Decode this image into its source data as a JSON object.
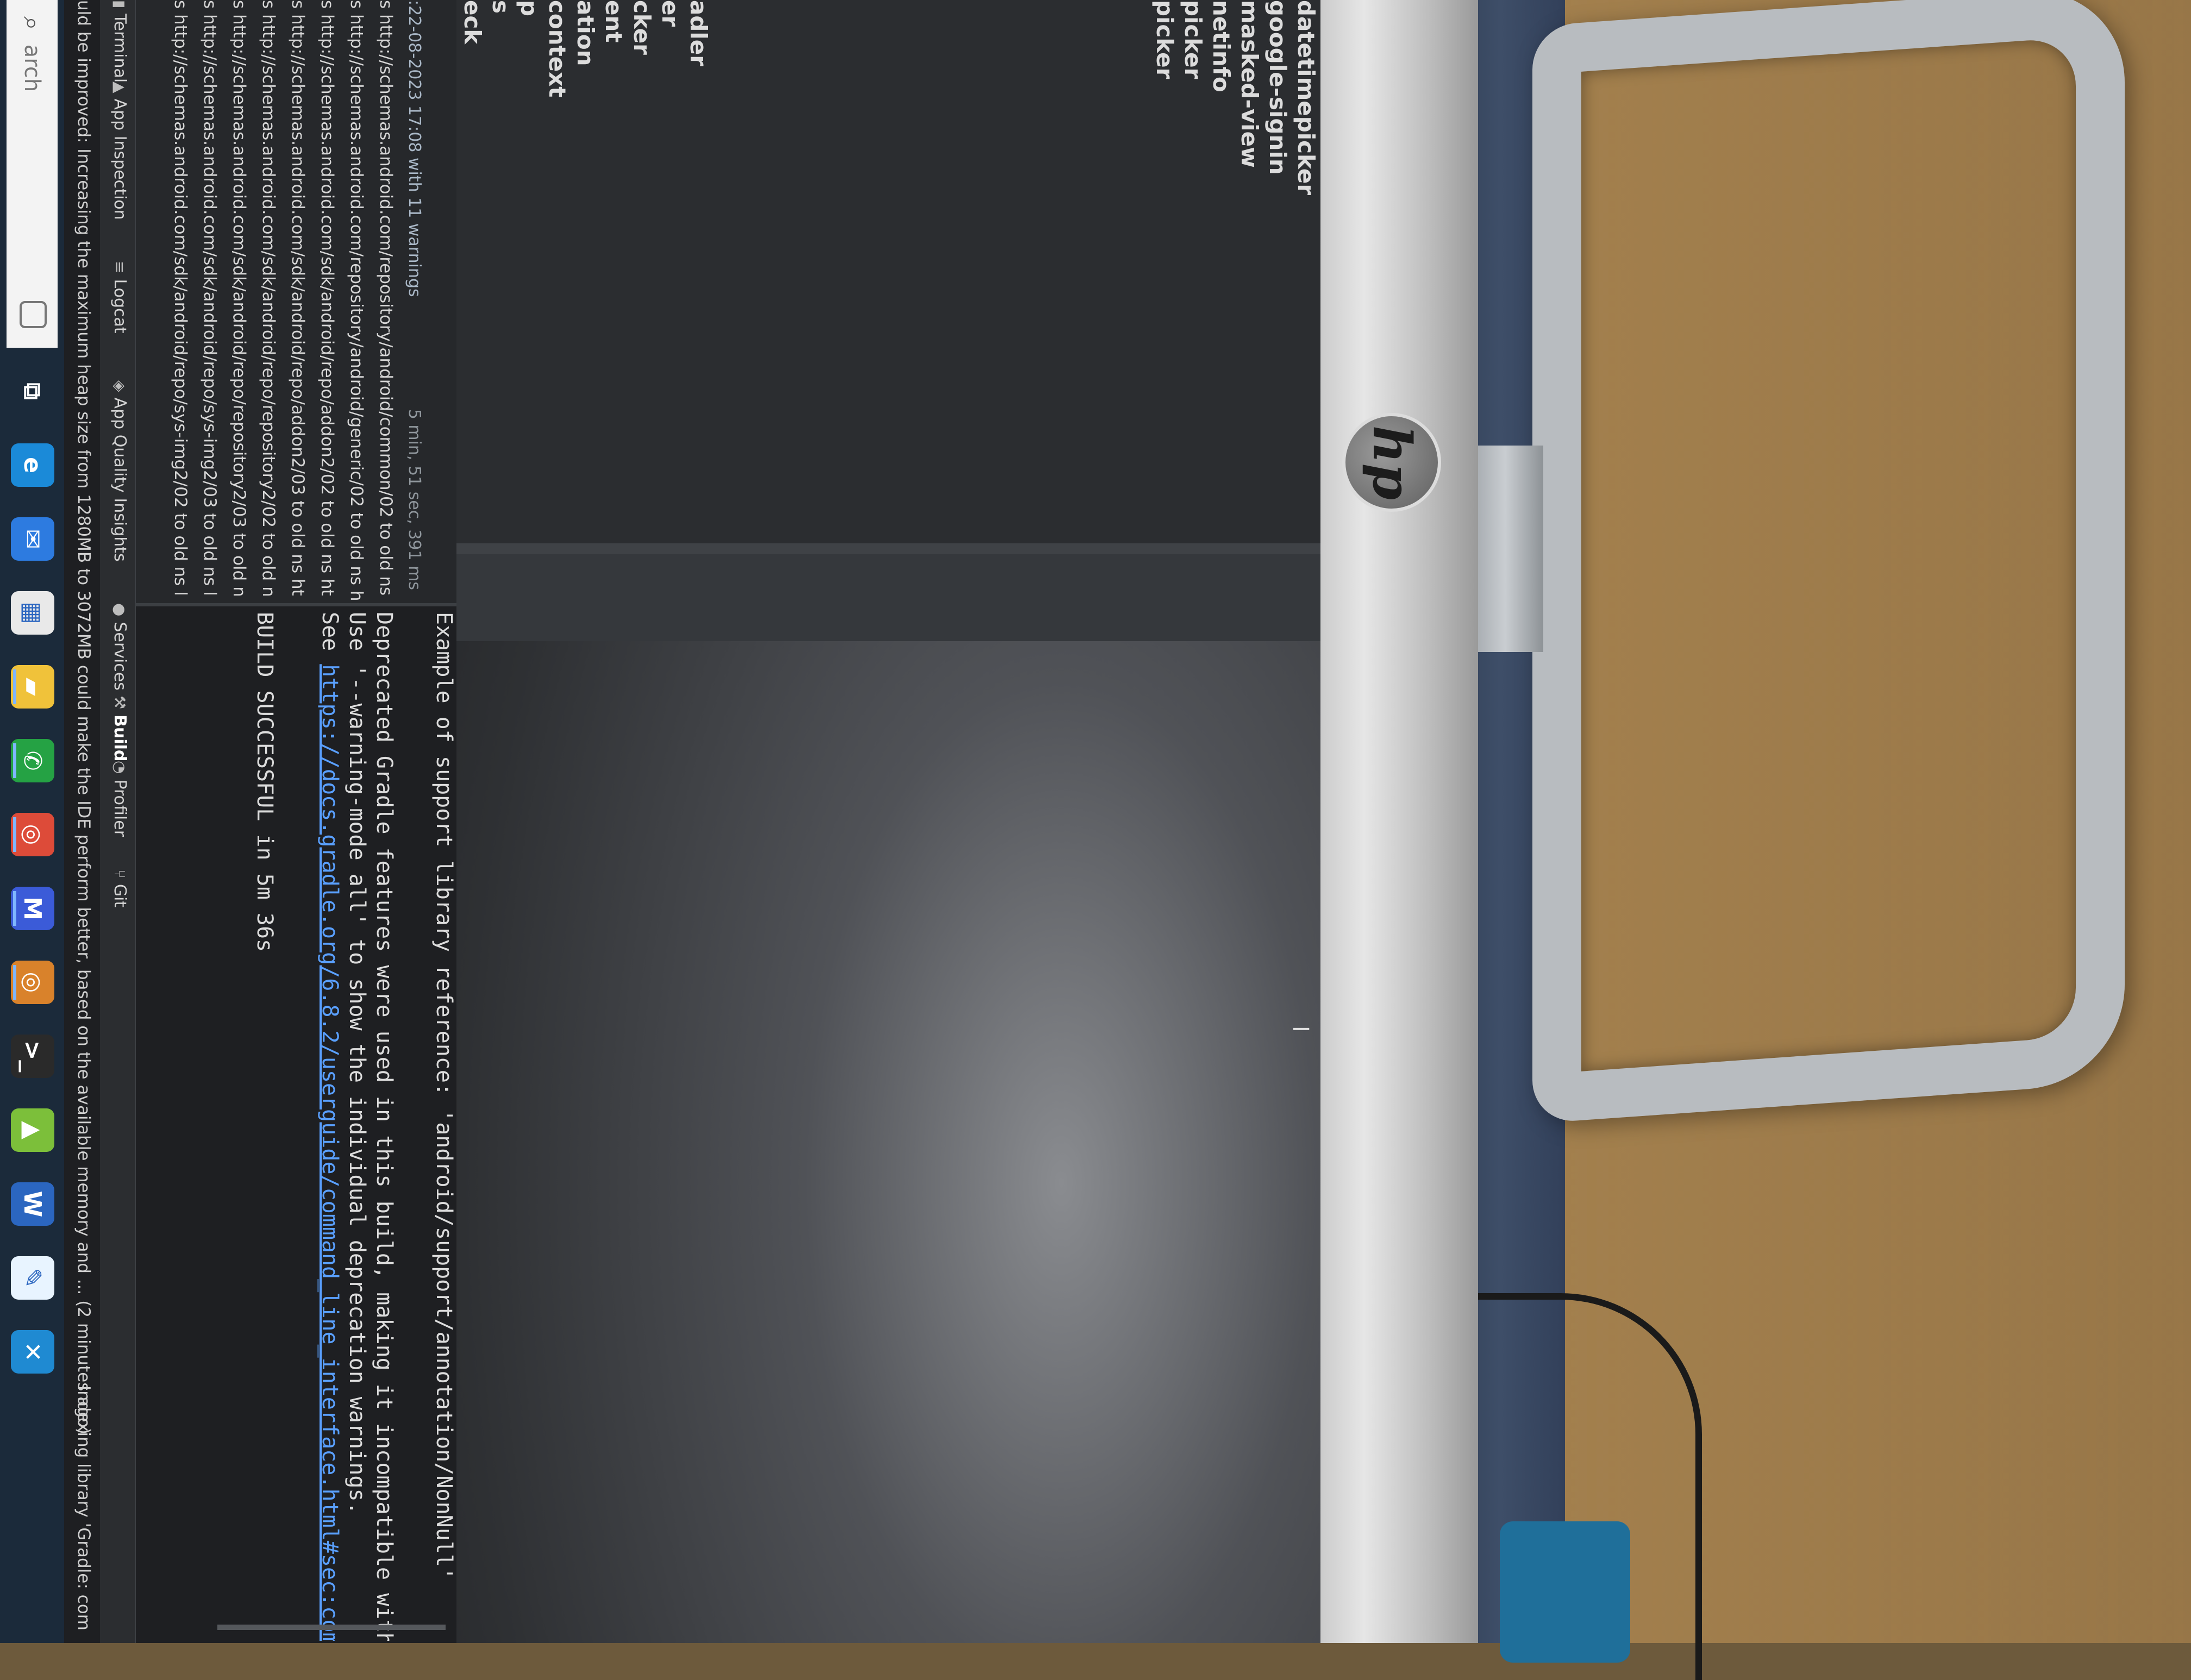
{
  "project_tree": {
    "items": [
      "datetimepicker",
      "google-signin",
      "masked-view",
      "netinfo",
      "picker",
      "picker",
      "adler",
      "er",
      "cker",
      "ent",
      "ation",
      "context",
      "p",
      "s",
      "eck"
    ]
  },
  "editor": {
    "cursor_glyph": "I"
  },
  "build_panel": {
    "header_when": ":22-08-2023 17:08 with 11 warnings",
    "header_duration": "5 min, 51 sec, 391 ms",
    "warnings": [
      "s http://schemas.android.com/repository/android/common/02 to old ns",
      "s http://schemas.android.com/repository/android/generic/02 to old ns h",
      "s http://schemas.android.com/sdk/android/repo/addon2/02 to old ns ht",
      "s http://schemas.android.com/sdk/android/repo/addon2/03 to old ns ht",
      "s http://schemas.android.com/sdk/android/repo/repository2/02 to old n",
      "s http://schemas.android.com/sdk/android/repo/repository2/03 to old n",
      "s http://schemas.android.com/sdk/android/repo/sys-img2/03 to old ns l",
      "s http://schemas.android.com/sdk/android/repo/sys-img2/02 to old ns l"
    ]
  },
  "console": {
    "line_top": "Example of support library reference: 'android/support/annotation/NonNull'",
    "deprecated_line": "Deprecated Gradle features were used in this build, making it incompatible with",
    "warning_mode_line": "Use '--warning-mode all' to show the individual deprecation warnings.",
    "see_prefix": "See ",
    "see_link": "https://docs.gradle.org/6.8.2/userguide/command_line_interface.html#sec:comm",
    "build_result": "BUILD SUCCESSFUL in 5m 36s"
  },
  "tool_tabs": [
    {
      "icon": "terminal-icon",
      "glyph": "▮",
      "label": "Terminal"
    },
    {
      "icon": "app-inspection-icon",
      "glyph": "▲",
      "label": "App Inspection"
    },
    {
      "icon": "logcat-icon",
      "glyph": "≡",
      "label": "Logcat"
    },
    {
      "icon": "app-quality-icon",
      "glyph": "◈",
      "label": "App Quality Insights"
    },
    {
      "icon": "services-icon",
      "glyph": "●",
      "label": "Services"
    },
    {
      "icon": "build-icon",
      "glyph": "⚒",
      "label": "Build"
    },
    {
      "icon": "profiler-icon",
      "glyph": "◔",
      "label": "Profiler"
    },
    {
      "icon": "git-icon",
      "glyph": "⑂",
      "label": "Git"
    }
  ],
  "status_bar": {
    "message": "uld be improved: Increasing the maximum heap size from 1280MB to 3072MB could make the IDE perform better, based on the available memory and ... (2 minutes ago)",
    "indexing": "Indexing library 'Gradle: com"
  },
  "taskbar": {
    "search_placeholder": "arch",
    "search_glyph": "⌕",
    "apps": [
      {
        "name": "task-view-icon",
        "glyph": "⧉",
        "color": "#1b2a3a"
      },
      {
        "name": "edge-icon",
        "glyph": "e",
        "color": "#1b8ad8"
      },
      {
        "name": "mail-icon",
        "glyph": "✉",
        "color": "#2d7be0"
      },
      {
        "name": "store-icon",
        "glyph": "▦",
        "color": "#e9e9e9"
      },
      {
        "name": "file-explorer-icon",
        "glyph": "▰",
        "color": "#f0c23a"
      },
      {
        "name": "whatsapp-icon",
        "glyph": "✆",
        "color": "#25a244"
      },
      {
        "name": "chrome-icon",
        "glyph": "◎",
        "color": "#dd4b39"
      },
      {
        "name": "meet-icon",
        "glyph": "M",
        "color": "#3b5bd8"
      },
      {
        "name": "chrome-canary-icon",
        "glyph": "◎",
        "color": "#d9822b"
      },
      {
        "name": "terminal-app-icon",
        "glyph": ">_",
        "color": "#2a2a2a"
      },
      {
        "name": "android-studio-icon",
        "glyph": "▲",
        "color": "#7cbf3a"
      },
      {
        "name": "word-icon",
        "glyph": "W",
        "color": "#2b66c0"
      },
      {
        "name": "notes-app-icon",
        "glyph": "✎",
        "color": "#e8f4ff"
      },
      {
        "name": "vscode-icon",
        "glyph": "✕",
        "color": "#1f8ad2"
      }
    ]
  },
  "monitor": {
    "brand": "hp"
  }
}
